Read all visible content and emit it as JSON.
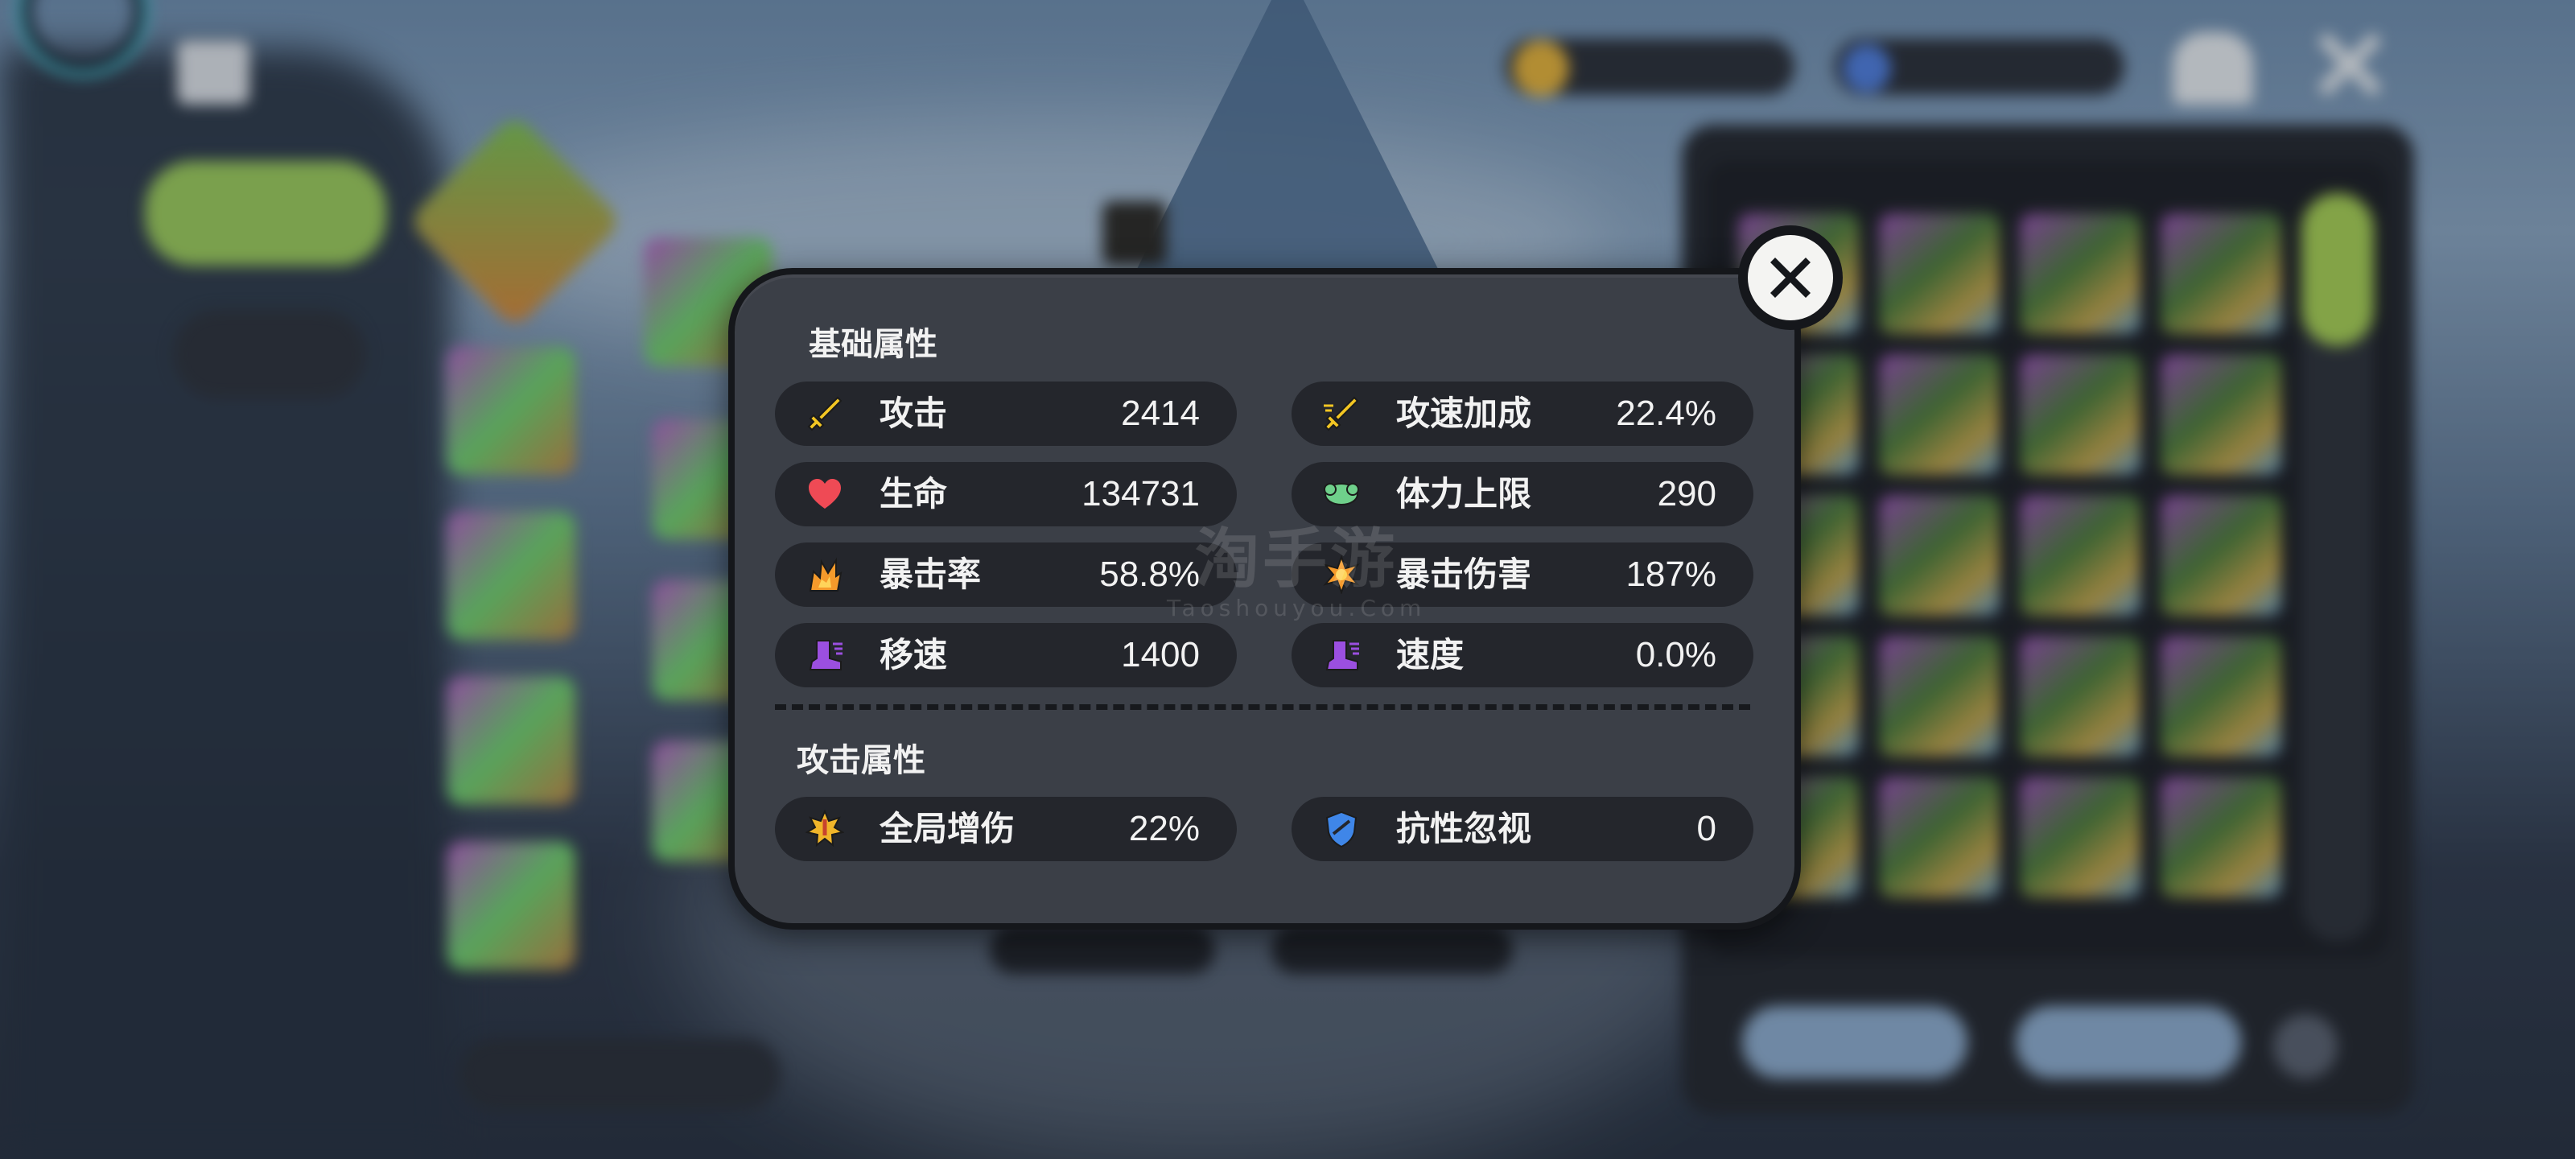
{
  "modal": {
    "close_icon": "close-x-icon",
    "sections": [
      {
        "title": "基础属性",
        "stats": [
          {
            "label": "攻击",
            "value": "2414",
            "icon": "sword-icon",
            "color": "#f3c623"
          },
          {
            "label": "攻速加成",
            "value": "22.4%",
            "icon": "attack-speed-sword-icon",
            "color": "#f3c623"
          },
          {
            "label": "生命",
            "value": "134731",
            "icon": "heart-icon",
            "color": "#ef4a55"
          },
          {
            "label": "体力上限",
            "value": "290",
            "icon": "stamina-muscle-icon",
            "color": "#6fd08b"
          },
          {
            "label": "暴击率",
            "value": "58.8%",
            "icon": "crit-burst-icon",
            "color": "#f59a2b"
          },
          {
            "label": "暴击伤害",
            "value": "187%",
            "icon": "crit-damage-burst-icon",
            "color": "#f59a2b"
          },
          {
            "label": "移速",
            "value": "1400",
            "icon": "boot-icon",
            "color": "#9b4fe0"
          },
          {
            "label": "速度",
            "value": "0.0%",
            "icon": "boot-icon",
            "color": "#9b4fe0"
          }
        ]
      },
      {
        "title": "攻击属性",
        "stats": [
          {
            "label": "全局增伤",
            "value": "22%",
            "icon": "damage-boost-icon",
            "color": "#f0b52a"
          },
          {
            "label": "抗性忽视",
            "value": "0",
            "icon": "broken-shield-icon",
            "color": "#3f86e8"
          }
        ]
      }
    ]
  },
  "watermark": {
    "brand": "淘手游",
    "site": "Taoshouyou.Com"
  }
}
